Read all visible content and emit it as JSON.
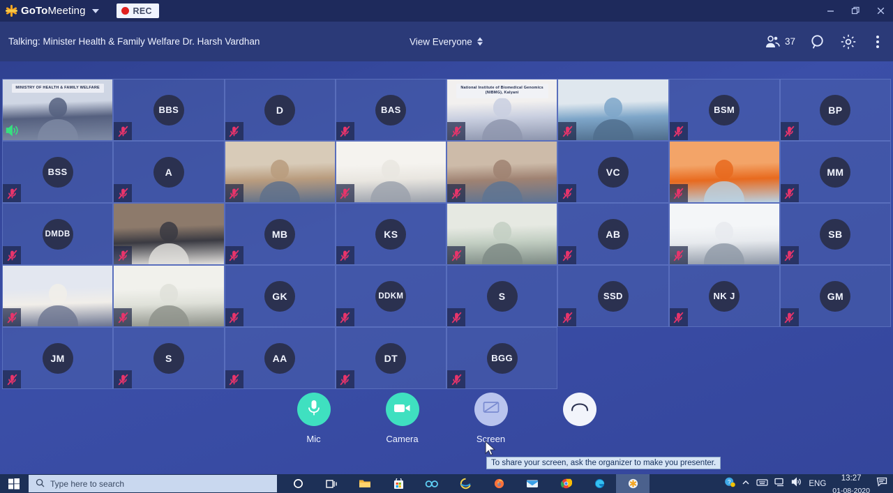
{
  "app": {
    "brand_bold": "GoTo",
    "brand_regular": "Meeting",
    "logo_icon": "asterisk-icon",
    "dropdown_icon": "chevron-down-icon",
    "recording_label": "REC",
    "window_controls": {
      "minimize": "minimize-icon",
      "restore": "restore-icon",
      "close": "close-icon"
    }
  },
  "toolbar": {
    "talking_label": "Talking: Minister Health & Family Welfare Dr. Harsh Vardhan",
    "view_mode": "View Everyone",
    "view_mode_icon": "up-down-chevron-icon",
    "participants_icon": "people-icon",
    "participants_count": "37",
    "search_icon": "search-icon",
    "settings_icon": "gear-icon",
    "more_icon": "kebab-menu-icon"
  },
  "grid": {
    "columns": 8,
    "rows": 5,
    "tiles": [
      {
        "type": "video",
        "name": "ministry-of-health-banner",
        "muted": false,
        "speaking": true,
        "banner_line1": "MINISTRY OF HEALTH",
        "banner_line2": "&",
        "banner_line3": "FAMILY WELFARE"
      },
      {
        "type": "avatar",
        "initials": "BBS",
        "muted": true
      },
      {
        "type": "avatar",
        "initials": "D",
        "muted": true
      },
      {
        "type": "avatar",
        "initials": "BAS",
        "muted": true
      },
      {
        "type": "video",
        "name": "nibmg-kalyani-banner",
        "muted": true,
        "banner_line1": "National Institute of Biomedical Genomics (NIBMG), Kalyani"
      },
      {
        "type": "video",
        "name": "masked-participants",
        "muted": true
      },
      {
        "type": "avatar",
        "initials": "BSM",
        "muted": true
      },
      {
        "type": "avatar",
        "initials": "BP",
        "muted": true
      },
      {
        "type": "avatar",
        "initials": "BSS",
        "muted": true
      },
      {
        "type": "avatar",
        "initials": "A",
        "muted": true
      },
      {
        "type": "video",
        "name": "two-men-seated",
        "muted": true
      },
      {
        "type": "video",
        "name": "bearded-man-white-shirt",
        "muted": true
      },
      {
        "type": "video",
        "name": "man-with-phone-at-desk",
        "muted": true
      },
      {
        "type": "avatar",
        "initials": "VC",
        "muted": true
      },
      {
        "type": "video",
        "name": "man-orange-background",
        "muted": true
      },
      {
        "type": "avatar",
        "initials": "MM",
        "muted": true
      },
      {
        "type": "avatar",
        "initials": "DMDB",
        "muted": true
      },
      {
        "type": "video",
        "name": "man-with-moustache",
        "muted": true
      },
      {
        "type": "avatar",
        "initials": "MB",
        "muted": true
      },
      {
        "type": "avatar",
        "initials": "KS",
        "muted": true
      },
      {
        "type": "video",
        "name": "man-with-glasses-green-shirt",
        "muted": true
      },
      {
        "type": "avatar",
        "initials": "AB",
        "muted": true
      },
      {
        "type": "video",
        "name": "man-white-shirt-office",
        "muted": true
      },
      {
        "type": "avatar",
        "initials": "SB",
        "muted": true
      },
      {
        "type": "video",
        "name": "woman-with-glasses",
        "muted": true
      },
      {
        "type": "video",
        "name": "man-bald-white-shirt",
        "muted": true
      },
      {
        "type": "avatar",
        "initials": "GK",
        "muted": true
      },
      {
        "type": "avatar",
        "initials": "DDKM",
        "muted": true
      },
      {
        "type": "avatar",
        "initials": "S",
        "muted": true
      },
      {
        "type": "avatar",
        "initials": "SSD",
        "muted": true
      },
      {
        "type": "avatar",
        "initials": "NK J",
        "muted": true
      },
      {
        "type": "avatar",
        "initials": "GM",
        "muted": true
      },
      {
        "type": "avatar",
        "initials": "JM",
        "muted": true
      },
      {
        "type": "avatar",
        "initials": "S",
        "muted": true
      },
      {
        "type": "avatar",
        "initials": "AA",
        "muted": true
      },
      {
        "type": "avatar",
        "initials": "DT",
        "muted": true
      },
      {
        "type": "avatar",
        "initials": "BGG",
        "muted": true
      },
      {
        "type": "empty"
      },
      {
        "type": "empty"
      },
      {
        "type": "empty"
      }
    ]
  },
  "controls": [
    {
      "label": "Mic",
      "icon": "microphone-icon",
      "state": "on"
    },
    {
      "label": "Camera",
      "icon": "camera-icon",
      "state": "on"
    },
    {
      "label": "Screen",
      "icon": "screen-share-disabled-icon",
      "state": "disabled"
    },
    {
      "label": "",
      "icon": "hang-up-icon",
      "state": "white"
    }
  ],
  "tooltip": {
    "text": "To share your screen, ask the organizer to make you presenter."
  },
  "taskbar": {
    "start_icon": "windows-start-icon",
    "search_icon": "search-icon",
    "search_placeholder": "Type here to search",
    "apps": [
      {
        "name": "cortana-icon"
      },
      {
        "name": "task-view-icon"
      },
      {
        "name": "file-explorer-icon"
      },
      {
        "name": "microsoft-store-icon"
      },
      {
        "name": "office-icon"
      },
      {
        "name": "internet-explorer-icon"
      },
      {
        "name": "firefox-icon"
      },
      {
        "name": "mail-icon"
      },
      {
        "name": "chrome-icon"
      },
      {
        "name": "edge-icon"
      },
      {
        "name": "gotomeeting-icon"
      }
    ],
    "tray": {
      "action_center_icon": "help-icon",
      "overflow_icon": "chevron-up-icon",
      "keyboard_icon": "keyboard-icon",
      "network_icon": "network-icon",
      "volume_icon": "volume-icon",
      "language": "ENG",
      "time": "13:27",
      "date": "01-08-2020",
      "notifications_icon": "notifications-icon"
    }
  },
  "colors": {
    "accent_teal": "#3fe0c0",
    "brand_orange": "#f5a623",
    "muted_red": "#e8346b",
    "background_blue": "#3b4fa8",
    "titlebar": "#1e2a5c"
  }
}
